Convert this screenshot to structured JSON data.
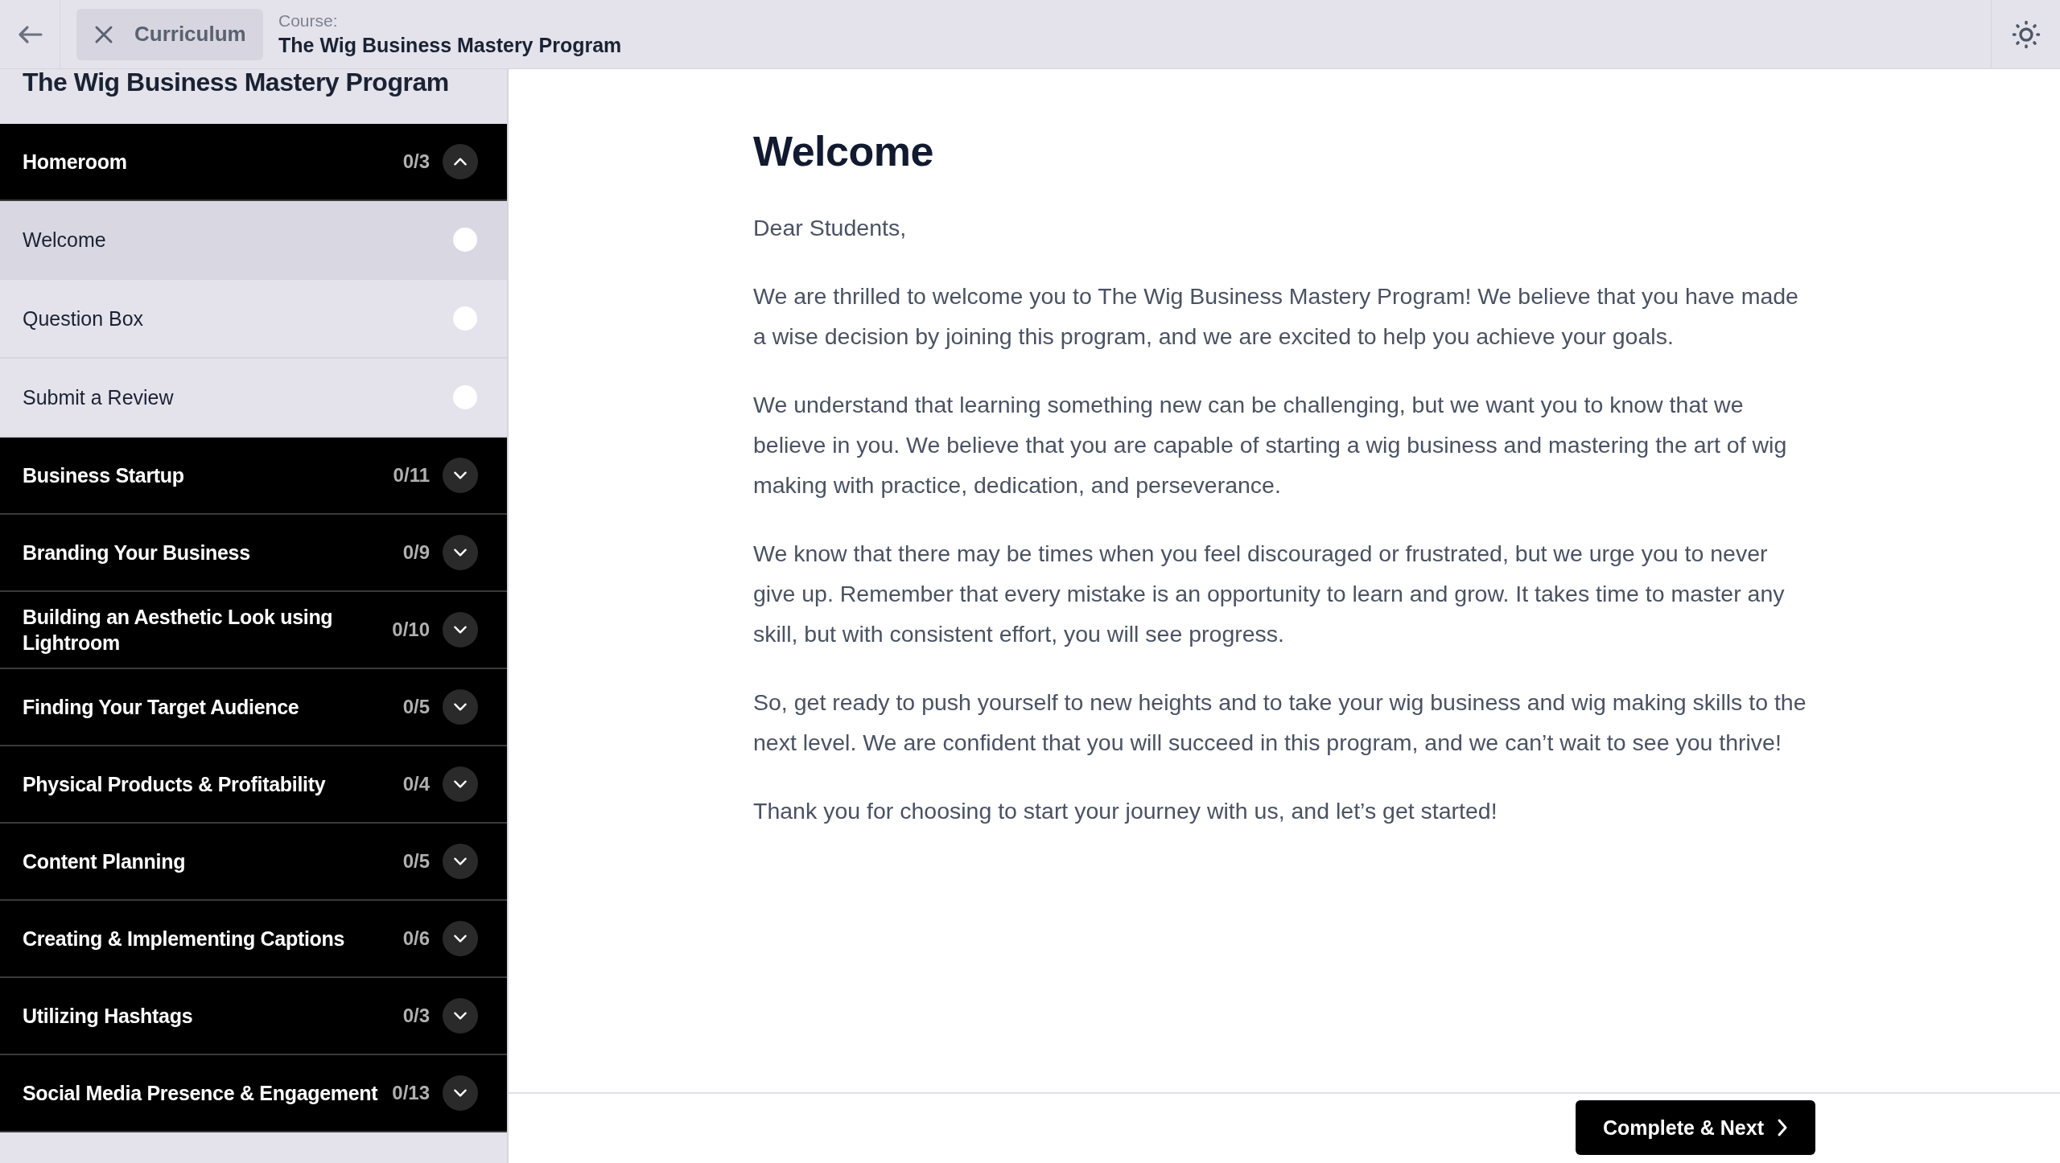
{
  "top_bar": {
    "close_label": "Curriculum",
    "course_label": "Course:",
    "course_name": "The Wig Business Mastery Program"
  },
  "sidebar": {
    "title": "The Wig Business Mastery Program",
    "sections": [
      {
        "title": "Homeroom",
        "progress": "0/3",
        "expanded": true,
        "lessons": [
          {
            "title": "Welcome",
            "selected": true,
            "completed": false
          },
          {
            "title": "Question Box",
            "selected": false,
            "completed": false
          },
          {
            "title": "Submit a Review",
            "selected": false,
            "completed": false
          }
        ]
      },
      {
        "title": "Business Startup",
        "progress": "0/11",
        "expanded": false
      },
      {
        "title": "Branding Your Business",
        "progress": "0/9",
        "expanded": false
      },
      {
        "title": "Building an Aesthetic Look using Lightroom",
        "progress": "0/10",
        "expanded": false
      },
      {
        "title": "Finding Your Target Audience",
        "progress": "0/5",
        "expanded": false
      },
      {
        "title": "Physical Products & Profitability",
        "progress": "0/4",
        "expanded": false
      },
      {
        "title": "Content Planning",
        "progress": "0/5",
        "expanded": false
      },
      {
        "title": "Creating & Implementing Captions",
        "progress": "0/6",
        "expanded": false
      },
      {
        "title": "Utilizing Hashtags",
        "progress": "0/3",
        "expanded": false
      },
      {
        "title": "Social Media Presence & Engagement",
        "progress": "0/13",
        "expanded": false
      }
    ]
  },
  "lesson": {
    "heading": "Welcome",
    "paragraphs": [
      "Dear Students,",
      "We are thrilled to welcome you to The Wig Business Mastery Program! We believe that you have made a wise decision by joining this program, and we are excited to help you achieve your goals.",
      "We understand that learning something new can be challenging, but we want you to know that we believe in you. We believe that you are capable of starting a wig business and mastering the art of wig making with practice, dedication, and perseverance.",
      "We know that there may be times when you feel discouraged or frustrated, but we urge you to never give up. Remember that every mistake is an opportunity to learn and grow. It takes time to master any skill, but with consistent effort, you will see progress.",
      "So, get ready to push yourself to new heights and to take your wig business and wig making skills to the next level. We are confident that you will succeed in this program, and we can’t wait to see you thrive!",
      "Thank you for choosing to start your journey with us, and let’s get started!"
    ]
  },
  "footer": {
    "next_button": "Complete & Next"
  }
}
